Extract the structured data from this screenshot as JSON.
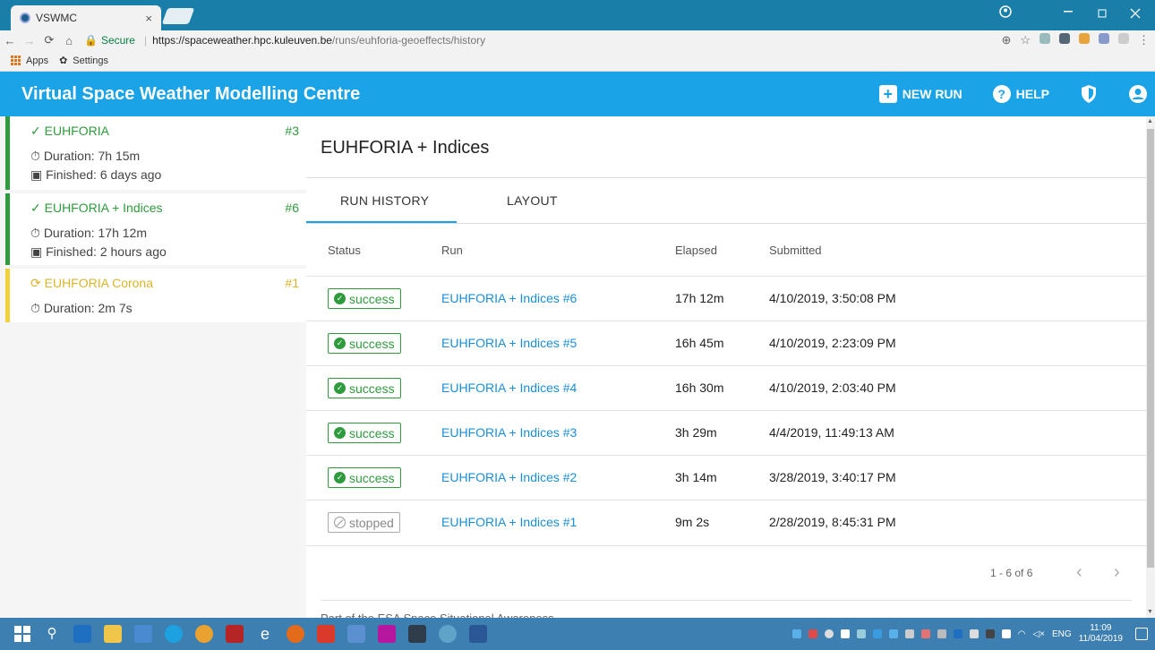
{
  "browser": {
    "tab_title": "VSWMC",
    "tab_close": "×",
    "url_secure_label": "Secure",
    "url_host": "https://spaceweather.hpc.kuleuven.be",
    "url_path": "/runs/euhforia-geoeffects/history",
    "bookmarks": [
      {
        "label": "Apps",
        "icon": "apps-grid-icon"
      },
      {
        "label": "Settings",
        "icon": "gear-icon"
      }
    ]
  },
  "header": {
    "title": "Virtual Space Weather Modelling Centre",
    "new_run_label": "NEW RUN",
    "help_label": "HELP",
    "accent": "#1ba3e8"
  },
  "sidebar": {
    "items": [
      {
        "name": "EUHFORIA",
        "number": "#3",
        "status": "done",
        "duration": "Duration: 7h 15m",
        "finished": "Finished: 6 days ago"
      },
      {
        "name": "EUHFORIA + Indices",
        "number": "#6",
        "status": "done",
        "duration": "Duration: 17h 12m",
        "finished": "Finished: 2 hours ago"
      },
      {
        "name": "EUHFORIA Corona",
        "number": "#1",
        "status": "running",
        "duration": "Duration: 2m 7s",
        "finished": null
      }
    ]
  },
  "main": {
    "title": "EUHFORIA + Indices",
    "tabs": [
      {
        "label": "RUN HISTORY",
        "active": true
      },
      {
        "label": "LAYOUT",
        "active": false
      }
    ],
    "columns": {
      "status": "Status",
      "run": "Run",
      "elapsed": "Elapsed",
      "submitted": "Submitted"
    },
    "rows": [
      {
        "status": "success",
        "run": "EUHFORIA + Indices #6",
        "elapsed": "17h 12m",
        "submitted": "4/10/2019, 3:50:08 PM"
      },
      {
        "status": "success",
        "run": "EUHFORIA + Indices #5",
        "elapsed": "16h 45m",
        "submitted": "4/10/2019, 2:23:09 PM"
      },
      {
        "status": "success",
        "run": "EUHFORIA + Indices #4",
        "elapsed": "16h 30m",
        "submitted": "4/10/2019, 2:03:40 PM"
      },
      {
        "status": "success",
        "run": "EUHFORIA + Indices #3",
        "elapsed": "3h 29m",
        "submitted": "4/4/2019, 11:49:13 AM"
      },
      {
        "status": "success",
        "run": "EUHFORIA + Indices #2",
        "elapsed": "3h 14m",
        "submitted": "3/28/2019, 3:40:17 PM"
      },
      {
        "status": "stopped",
        "run": "EUHFORIA + Indices #1",
        "elapsed": "9m 2s",
        "submitted": "2/28/2019, 8:45:31 PM"
      }
    ],
    "pagination": "1 - 6 of 6",
    "footer": "Part of the ESA Space Situational Awareness"
  },
  "taskbar": {
    "language": "ENG",
    "time": "11:09",
    "date": "11/04/2019"
  },
  "colors": {
    "success": "#2e9b3d",
    "running": "#d9b52a",
    "link": "#1a8fd8",
    "taskbar": "#3c7fb0"
  }
}
